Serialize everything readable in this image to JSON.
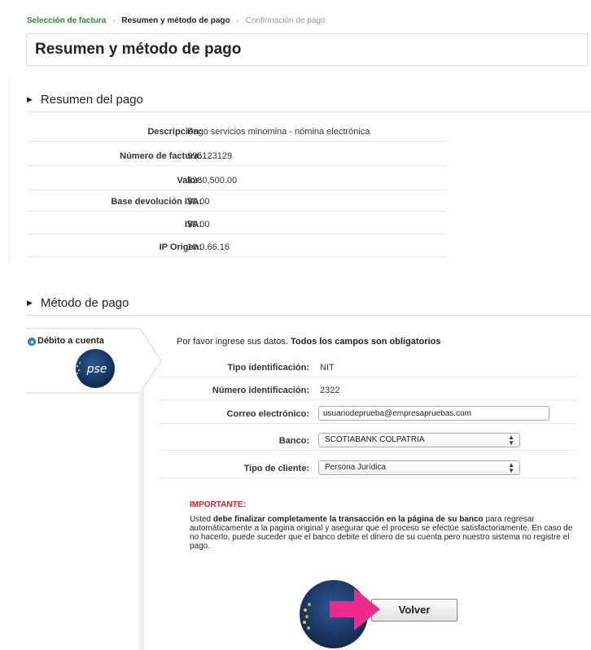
{
  "breadcrumb": {
    "items": [
      "Selección de factura",
      "Resumen y método de pago",
      "Confirmación de pago"
    ],
    "separator": "›"
  },
  "page_title": "Resumen y método de pago",
  "summary": {
    "heading": "Resumen del pago",
    "rows": [
      {
        "label": "Descripción:",
        "value": "Pago servicios minomina - nómina electrónica"
      },
      {
        "label": "Número de factura:",
        "value": "995123129"
      },
      {
        "label": "Valor:",
        "value": "$280,500.00"
      },
      {
        "label": "Base devolución IVA:",
        "value": "$0.00"
      },
      {
        "label": "IVA:",
        "value": "$0.00"
      },
      {
        "label": "IP Origen:",
        "value": "10.0.66.16"
      }
    ]
  },
  "payment": {
    "heading": "Método de pago",
    "option_label": "Débito a cuenta",
    "logo_text": "pse",
    "intro_text": "Por favor ingrese sus datos. ",
    "intro_bold": "Todos los campos son obligatorios",
    "fields": {
      "tipo_id": {
        "label": "Tipo identificación:",
        "value": "NIT"
      },
      "numero_id": {
        "label": "Número identificación:",
        "value": "2322"
      },
      "correo": {
        "label": "Correo electrónico:",
        "value": "usuariodeprueba@empresapruebas.com"
      },
      "banco": {
        "label": "Banco:",
        "value": "SCOTIABANK COLPATRIA"
      },
      "tipo_cliente": {
        "label": "Tipo de cliente:",
        "value": "Persona Jurídica"
      }
    },
    "important": {
      "title": "IMPORTANTE:",
      "text_1": "Usted ",
      "text_bold": "debe finalizar completamente la transacción en la página de su banco",
      "text_2": " para regresar automáticamente a la pagina original y asegurar que el proceso se efectúe satisfactoriamente. En caso de no hacerlo, puede suceder que el banco debite el dinero de su cuenta pero nuestro sistema no registre el pago."
    },
    "back_button": "Volver"
  },
  "colors": {
    "breadcrumb_active": "#2e8b2e",
    "important_red": "#d0232a",
    "radio_blue": "#2a8fd6",
    "arrow_pink": "#ee2a8c",
    "pse_navy": "#1b3a68"
  },
  "icons": [
    "radio-selected-icon",
    "pse-logo-icon",
    "pink-arrow-icon",
    "select-arrows-icon"
  ]
}
